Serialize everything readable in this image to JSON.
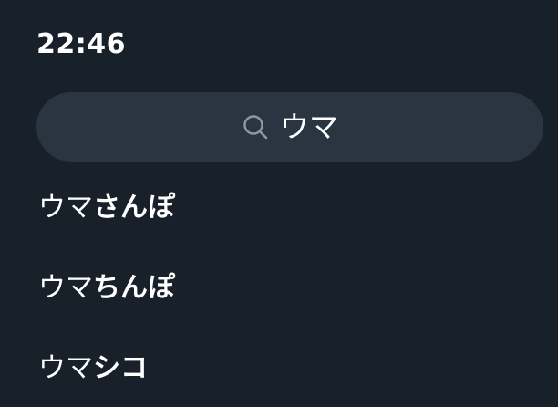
{
  "status": {
    "time": "22:46"
  },
  "search": {
    "query": "ウマ",
    "icon": "search-icon"
  },
  "suggestions": [
    {
      "match": "ウマ",
      "rest": "さんぽ"
    },
    {
      "match": "ウマ",
      "rest": "ちんぽ"
    },
    {
      "match": "ウマ",
      "rest": "シコ"
    }
  ],
  "colors": {
    "background": "#18202a",
    "search_bar": "#293541",
    "text": "#ffffff",
    "icon": "#8b98a5"
  }
}
